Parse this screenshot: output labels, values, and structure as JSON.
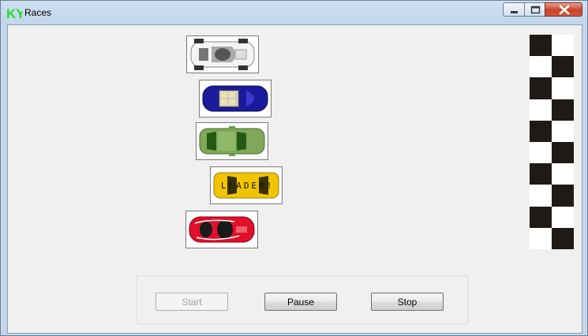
{
  "window": {
    "title": "Races",
    "icon_text": "KY",
    "icon_color": "#22dd22"
  },
  "cars": [
    {
      "name": "white",
      "color": "#e8e8e8",
      "label": ""
    },
    {
      "name": "blue",
      "color": "#1a1a9c",
      "label": ""
    },
    {
      "name": "green",
      "color": "#7fa85a",
      "label": ""
    },
    {
      "name": "yellow",
      "color": "#f2c400",
      "label": "LEADER!"
    },
    {
      "name": "red",
      "color": "#e0102a",
      "label": ""
    }
  ],
  "buttons": {
    "start": "Start",
    "pause": "Pause",
    "stop": "Stop"
  },
  "colors": {
    "flag_dark": "#1f1a17",
    "flag_light": "#ffffff"
  }
}
